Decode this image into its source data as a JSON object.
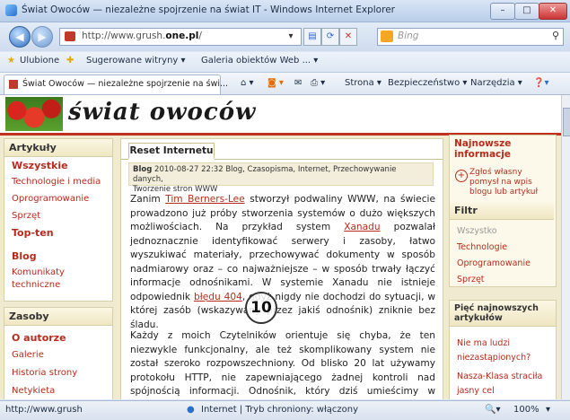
{
  "window": {
    "title": "Świat Owoców — niezależne spojrzenie na świat IT - Windows Internet Explorer",
    "controls": {
      "minimize": "–",
      "maximize": "□",
      "close": "✕"
    }
  },
  "toolbar": {
    "url_prefix": "http://www.grush.",
    "url_domain": "one.pl",
    "url_suffix": "/",
    "search_placeholder": "Bing"
  },
  "favorites": {
    "label": "Ulubione",
    "items": [
      "Sugerowane witryny ▾",
      "Galeria obiektów Web ... ▾"
    ]
  },
  "tabs": [
    {
      "label": "Świat Owoców — niezależne spojrzenie na świ..."
    }
  ],
  "commands": {
    "page": "Strona ▾",
    "security": "Bezpieczeństwo ▾",
    "tools": "Narzędzia ▾"
  },
  "site": {
    "title": "świat owoców"
  },
  "left_sidebar": {
    "sections": [
      {
        "heading": "Artykuły",
        "links": [
          "Wszystkie",
          "Technologie i media",
          "Oprogramowanie",
          "Sprzęt",
          "Top-ten",
          "Blog",
          "Komunikaty",
          "techniczne"
        ]
      },
      {
        "heading": "Zasoby",
        "links": [
          "O autorze",
          "Galerie",
          "Historia strony",
          "Netykieta"
        ]
      }
    ]
  },
  "article": {
    "tab": "Reset Internetu",
    "meta_title": "Blog",
    "meta_line1": " 2010-08-27 22:32  Blog, Czasopisma, Internet, Przechowywanie danych,",
    "meta_line2": "Tworzenie stron WWW",
    "p1_a": "Zanim ",
    "p1_link1": "Tim Berners-Lee",
    "p1_b": " stworzył podwaliny WWW, na świecie prowadzono już próby stworzenia systemów o dużo większych możliwościach. Na przykład system ",
    "p1_link2": "Xanadu",
    "p1_c": " pozwalał jednoznacznie identyfikować serwery i zasoby, łatwo wyszukiwać materiały, przechowywać dokumenty w sposób nadmiarowy oraz – co najważniejsze – w sposób trwały łączyć informacje odnośnikami. W systemie Xanadu nie istnieje odpowiednik ",
    "p1_link3": "błędu 404",
    "p1_d": ", gdyż nigdy nie dochodzi do sytuacji, w której zasób (wskazywany przez jakiś odnośnik) zniknie bez śladu.",
    "p2": "Każdy z moich Czytelników orientuje się chyba, że ten niezwykle funkcjonalny, ale też skomplikowany system nie został szeroko rozpowszechniony. Od blisko 20 lat używamy protokołu HTTP, nie zapewniającego żadnej kontroli nad spójnością informacji. Odnośnik, który dziś umieścimy w tworzonym dokumencie, jutro może wskazywać na zupełnie inną stronę, a pojutrze — prowa-",
    "badge": "10"
  },
  "right_sidebar": {
    "news_heading": "Najnowsze informacje",
    "report": "Zgłoś własny pomysł na wpis blogu lub artykuł",
    "filter_heading": "Filtr",
    "filters": [
      "Wszystko",
      "Technologie",
      "Oprogramowanie",
      "Sprzęt"
    ],
    "latest_heading": "Pięć najnowszych artykułów",
    "latest": [
      "Nie ma ludzi niezastąpionych?",
      "Nasza-Klasa straciła jasny cel"
    ]
  },
  "status": {
    "url": "http://www.grush",
    "zone": "Internet | Tryb chroniony: włączony",
    "zoom": "100%"
  },
  "colors": {
    "accent": "#b52b1c",
    "page_bg": "#f0ead0",
    "ie_frame": "#cfdcee"
  }
}
